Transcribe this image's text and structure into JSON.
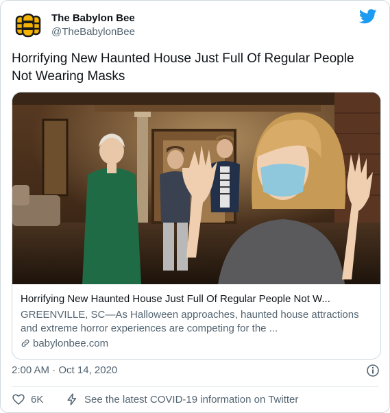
{
  "account": {
    "display_name": "The Babylon Bee",
    "handle": "@TheBabylonBee",
    "avatar_icon": "bee-logo-icon",
    "platform_icon": "twitter-bird-icon"
  },
  "tweet": {
    "text": "Horrifying New Haunted House Just Full Of Regular People Not Wearing Masks",
    "timestamp": "2:00 AM · Oct 14, 2020"
  },
  "card": {
    "title": "Horrifying New Haunted House Just Full Of Regular People Not W...",
    "description": "GREENVILLE, SC—As Halloween approaches, haunted house attractions and extreme horror experiences are competing for the ...",
    "domain": "babylonbee.com"
  },
  "actions": {
    "like_count": "6K",
    "covid_notice": "See the latest COVID-19 information on Twitter"
  },
  "colors": {
    "twitter_blue": "#1d9bf0",
    "bee_yellow": "#f5b301",
    "text_secondary": "#536471",
    "border": "#cfd9de"
  }
}
